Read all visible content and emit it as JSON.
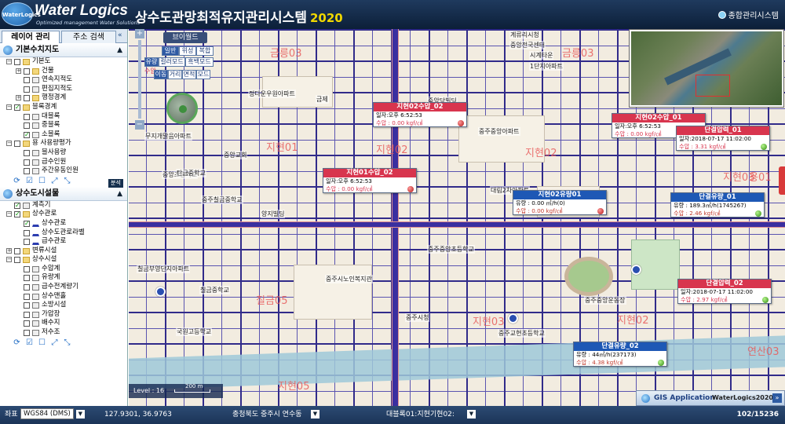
{
  "header": {
    "logo_badge": "WaterLogics",
    "brand": "Water Logics",
    "tagline": "Optimized management Water Solutions",
    "system_title": "상수도관망최적유지관리시스템",
    "year": "2020",
    "admin_link": "종합관리시스템"
  },
  "sidebar": {
    "tabs": [
      {
        "label": "레이어 관리",
        "active": true
      },
      {
        "label": "주소 검색",
        "active": false
      }
    ],
    "collapse_icon": "double-chevron-left-icon",
    "section1": {
      "title": "기본수치지도",
      "items": [
        {
          "label": "기본도",
          "level": 0,
          "pm": "-",
          "checked": false,
          "icon": "folder"
        },
        {
          "label": "건물",
          "level": 1,
          "pm": "+",
          "checked": false,
          "icon": "folder"
        },
        {
          "label": "연속지적도",
          "level": 1,
          "pm": "",
          "checked": false,
          "icon": "layer"
        },
        {
          "label": "편집지적도",
          "level": 1,
          "pm": "",
          "checked": false,
          "icon": "layer"
        },
        {
          "label": "행정경계",
          "level": 1,
          "pm": "+",
          "checked": false,
          "icon": "folder"
        },
        {
          "label": "블록경계",
          "level": 0,
          "pm": "-",
          "checked": true,
          "icon": "folder"
        },
        {
          "label": "대블록",
          "level": 1,
          "pm": "",
          "checked": false,
          "icon": "layer"
        },
        {
          "label": "중블록",
          "level": 1,
          "pm": "",
          "checked": false,
          "icon": "layer"
        },
        {
          "label": "소블록",
          "level": 1,
          "pm": "",
          "checked": true,
          "icon": "layer"
        },
        {
          "label": "용 사용량평가",
          "level": 0,
          "pm": "-",
          "checked": false,
          "icon": "folder"
        },
        {
          "label": "블사용량",
          "level": 1,
          "pm": "",
          "checked": false,
          "icon": "layer"
        },
        {
          "label": "급수인원",
          "level": 1,
          "pm": "",
          "checked": false,
          "icon": "layer"
        },
        {
          "label": "주간유동인원",
          "level": 1,
          "pm": "",
          "checked": false,
          "icon": "layer"
        }
      ],
      "badge": "분석"
    },
    "section2": {
      "title": "상수도시설물",
      "items": [
        {
          "label": "계측기",
          "level": 0,
          "pm": "",
          "checked": true,
          "icon": "layer"
        },
        {
          "label": "상수관로",
          "level": 0,
          "pm": "-",
          "checked": true,
          "icon": "folder"
        },
        {
          "label": "상수관로",
          "level": 1,
          "pm": "",
          "checked": true,
          "icon": "line"
        },
        {
          "label": "상수도관로라벨",
          "level": 1,
          "pm": "",
          "checked": false,
          "icon": "line"
        },
        {
          "label": "급수관로",
          "level": 1,
          "pm": "",
          "checked": false,
          "icon": "line"
        },
        {
          "label": "변류시설",
          "level": 0,
          "pm": "+",
          "checked": false,
          "icon": "folder"
        },
        {
          "label": "상수시설",
          "level": 0,
          "pm": "-",
          "checked": false,
          "icon": "folder"
        },
        {
          "label": "수압계",
          "level": 1,
          "pm": "",
          "checked": false,
          "icon": "layer"
        },
        {
          "label": "유량계",
          "level": 1,
          "pm": "",
          "checked": false,
          "icon": "layer"
        },
        {
          "label": "급수전계량기",
          "level": 1,
          "pm": "",
          "checked": false,
          "icon": "layer"
        },
        {
          "label": "상수맨홀",
          "level": 1,
          "pm": "",
          "checked": false,
          "icon": "layer"
        },
        {
          "label": "소방시설",
          "level": 1,
          "pm": "",
          "checked": false,
          "icon": "layer"
        },
        {
          "label": "가압장",
          "level": 1,
          "pm": "",
          "checked": false,
          "icon": "layer"
        },
        {
          "label": "배수지",
          "level": 1,
          "pm": "",
          "checked": false,
          "icon": "layer"
        },
        {
          "label": "저수조",
          "level": 1,
          "pm": "",
          "checked": false,
          "icon": "layer"
        }
      ]
    }
  },
  "map": {
    "nav": {
      "title": "브이월드",
      "modes": [
        "일반",
        "위성",
        "복합"
      ],
      "color_modes": [
        "유량",
        "컬러모드",
        "흑백모드"
      ],
      "tools": [
        "이동",
        "거리",
        "면적",
        "모드"
      ],
      "pressure_tag": "수압"
    },
    "zones": [
      "금릉03",
      "금릉03",
      "지현01",
      "지현02",
      "지현02",
      "지현03",
      "칠금05",
      "지현03",
      "지현02",
      "지현05",
      "용01",
      "연산03"
    ],
    "places": [
      "계류리시청",
      "중앙전국센터",
      "시계타운",
      "1단지아파트",
      "정다운우원아파트",
      "중앙당빌딩",
      "금제",
      "중주중앙아파트",
      "무지개맑음아파트",
      "중앙초등학교",
      "탄금중학교",
      "중주칠금중학교",
      "양지빌딩",
      "칠금부영단지아파트",
      "칠금중학교",
      "중주시노인복지관",
      "중주중앙초등학교",
      "국원고등학교",
      "중주교현초등학교",
      "중앙교회",
      "중주중앙운동장",
      "중주시청",
      "계소백",
      "대림2차아파트"
    ],
    "popups": [
      {
        "title": "지현02수압_02",
        "type": "red",
        "rows": [
          "일자:오후 6:52:53",
          "수압 : 0.00 kgf/㎠"
        ],
        "dot": "red"
      },
      {
        "title": "지현01수압_02",
        "type": "red",
        "rows": [
          "일자:오후 6:52:53",
          "수압 : 0.00 kgf/㎠"
        ],
        "dot": "red"
      },
      {
        "title": "지현02유량01",
        "type": "blue",
        "rows": [
          "유량 : 0.00 ㎥/h(0)",
          "수압 : 0.00 kgf/㎠"
        ],
        "dot": "red"
      },
      {
        "title": "지현02수압_01",
        "type": "red",
        "rows": [
          "일자:오후 6:52:53",
          "수압 : 0.00 kgf/㎠"
        ],
        "dot": "red"
      },
      {
        "title": "단결압력_01",
        "type": "red",
        "rows": [
          "일자:2018-07-17 11:02:00",
          "수압 : 3.31 kgf/㎠"
        ],
        "dot": "grn"
      },
      {
        "title": "단결유량_01",
        "type": "blue",
        "rows": [
          "유량 : 189.3㎥/h(1745267)",
          "수압 : 2.46 kgf/㎠"
        ],
        "dot": "grn"
      },
      {
        "title": "단결압력_02",
        "type": "red",
        "rows": [
          "일자:2018-07-17 11:02:00",
          "수압 : 2.97 kgf/㎠"
        ],
        "dot": "grn"
      },
      {
        "title": "단결유량_02",
        "type": "blue",
        "rows": [
          "유량 : 44㎥/h(237173)",
          "수압 : 4.38 kgf/㎠"
        ],
        "dot": "grn"
      }
    ],
    "scale": {
      "level": "Level : 16",
      "distance": "200 m"
    },
    "gis": {
      "app": "GIS Application",
      "brand": "WaterLogics2020",
      "arrow": "»"
    }
  },
  "footer": {
    "coord_label": "좌표",
    "crs": "WGS84 (DMS)",
    "coords": "127.9301, 36.9763",
    "region": "충청북도 중주시 연수동",
    "block": "대블록01:지현기현02:",
    "page": "102/15236"
  }
}
